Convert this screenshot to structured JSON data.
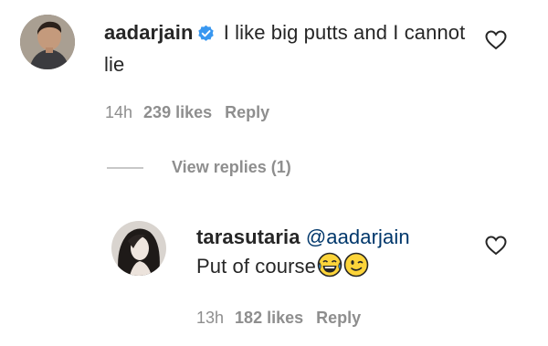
{
  "comment": {
    "username": "aadarjain",
    "text": "I like big putts and I cannot lie",
    "time": "14h",
    "likes": "239 likes",
    "reply_label": "Reply",
    "verified_icon": "verified-badge-icon",
    "heart_icon": "heart-outline-icon"
  },
  "view_replies": {
    "label": "View replies (1)"
  },
  "reply": {
    "username": "tarasutaria",
    "mention": "@aadarjain",
    "text": "Put of course",
    "emojis": [
      "laughing-tears-emoji",
      "winking-face-emoji"
    ],
    "time": "13h",
    "likes": "182 likes",
    "reply_label": "Reply",
    "heart_icon": "heart-outline-icon"
  },
  "colors": {
    "text": "#262626",
    "muted": "#8e8e8e",
    "verified": "#3897f0",
    "mention": "#00376b"
  }
}
